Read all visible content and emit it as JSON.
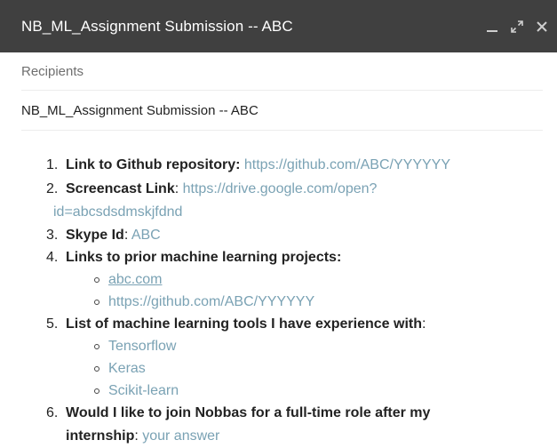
{
  "window": {
    "title": "NB_ML_Assignment Submission -- ABC"
  },
  "compose": {
    "recipients_placeholder": "Recipients",
    "subject": "NB_ML_Assignment Submission -- ABC"
  },
  "body": {
    "items": [
      {
        "num": "1.",
        "key": "Link to Github repository:",
        "sep": " ",
        "value": "https://github.com/ABC/YYYYYY"
      },
      {
        "num": "2.",
        "key": "Screencast Link",
        "sep": ": ",
        "value": "https://drive.google.com/open?",
        "value2": "id=abcsdsdmskjfdnd"
      },
      {
        "num": "3.",
        "key": "Skype Id",
        "sep": ": ",
        "value": "ABC"
      },
      {
        "num": "4.",
        "key": "Links to prior machine learning projects:",
        "sub": [
          "abc.com",
          "https://github.com/ABC/YYYYYY"
        ]
      },
      {
        "num": "5.",
        "key": "List of machine learning tools I have experience with",
        "sep": ":",
        "sub": [
          "Tensorflow",
          "Keras",
          "Scikit-learn"
        ]
      },
      {
        "num": "6.",
        "key": "Would I like to join Nobbas for a full-time role after my",
        "key2": "internship",
        "sep": ": ",
        "value": "your answer"
      }
    ]
  },
  "colors": {
    "titlebar": "#404040",
    "link": "#7aa2b4"
  }
}
